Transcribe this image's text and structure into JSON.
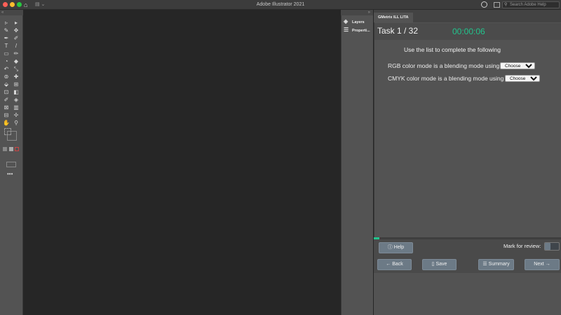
{
  "window": {
    "title": "Adobe Illustrator 2021",
    "search_placeholder": "Search Adobe Help",
    "search_icon": "magnifier-icon",
    "traffic_colors": [
      "#ff5f57",
      "#febc2e",
      "#28c840"
    ]
  },
  "dock": {
    "items": [
      {
        "label": "Layers",
        "icon": "layers-icon"
      },
      {
        "label": "Properti...",
        "icon": "properties-icon"
      }
    ]
  },
  "panel": {
    "tab": "GMetrix ILL LITA",
    "task_label": "Task 1 / 32",
    "timer": "00:00:06",
    "timer_color": "#21c48c",
    "instruction": "Use the list to complete the following",
    "questions": [
      {
        "text": "RGB color mode is a blending mode using",
        "select_value": "Choose one"
      },
      {
        "text": "CMYK color mode is a blending mode using",
        "select_value": "Choose one"
      }
    ],
    "progress_fraction": 0.031,
    "help_label": "Help",
    "mark_label": "Mark for review:",
    "back_label": "Back",
    "save_label": "Save",
    "summary_label": "Summary",
    "next_label": "Next"
  },
  "tools": {
    "glyphs": [
      "▹",
      "▸",
      "✎",
      "✥",
      "✒",
      "✐",
      "T",
      "/",
      "▭",
      "✏",
      "◔",
      "◆",
      "↶",
      "⤡",
      "⊚",
      "✚",
      "⬙",
      "⊞",
      "⊡",
      "◧",
      "✐",
      "◈",
      "⊠",
      "▥",
      "⊟",
      "✢",
      "✋",
      "⚲"
    ],
    "more": "•••"
  }
}
